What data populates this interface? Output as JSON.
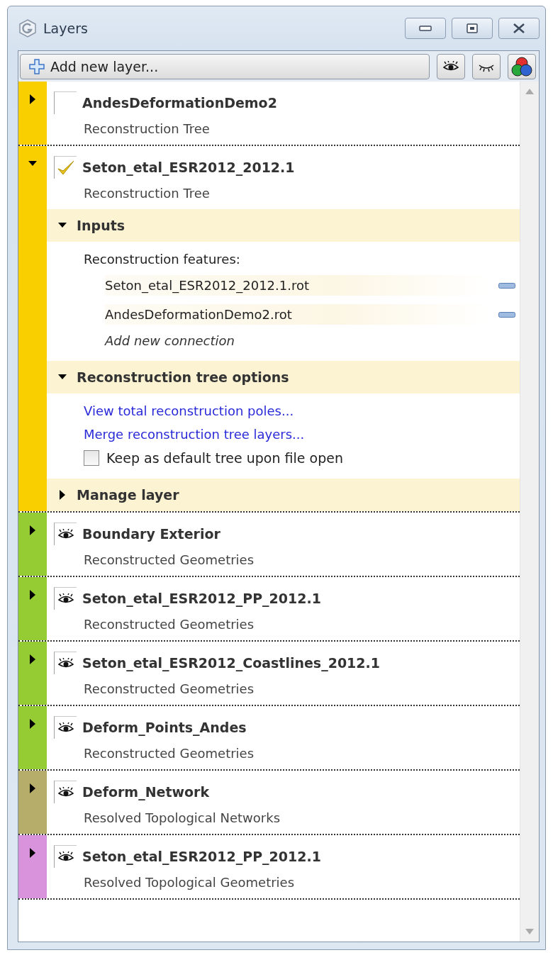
{
  "window": {
    "title": "Layers"
  },
  "toolbar": {
    "add_button": "Add new layer..."
  },
  "layers": [
    {
      "name": "AndesDeformationDemo2",
      "type": "Reconstruction Tree",
      "color": "#f9cf00",
      "expanded": false,
      "kind": "checkbox",
      "checked": false
    },
    {
      "name": "Seton_etal_ESR2012_2012.1",
      "type": "Reconstruction Tree",
      "color": "#f9cf00",
      "expanded": true,
      "kind": "checkbox",
      "checked": true,
      "sections": [
        {
          "kind": "inputs",
          "title": "Inputs",
          "expanded": true,
          "label": "Reconstruction features:",
          "connections": [
            "Seton_etal_ESR2012_2012.1.rot",
            "AndesDeformationDemo2.rot"
          ],
          "add_connection": "Add new connection"
        },
        {
          "kind": "options",
          "title": "Reconstruction tree options",
          "expanded": true,
          "links": [
            "View total reconstruction poles...",
            "Merge reconstruction tree layers..."
          ],
          "option": {
            "label": "Keep as default tree upon file open",
            "checked": false
          }
        },
        {
          "kind": "manage",
          "title": "Manage layer",
          "expanded": false
        }
      ]
    },
    {
      "name": "Boundary Exterior",
      "type": "Reconstructed Geometries",
      "color": "#95cc33",
      "expanded": false,
      "kind": "eye",
      "visible": true
    },
    {
      "name": "Seton_etal_ESR2012_PP_2012.1",
      "type": "Reconstructed Geometries",
      "color": "#95cc33",
      "expanded": false,
      "kind": "eye",
      "visible": true
    },
    {
      "name": "Seton_etal_ESR2012_Coastlines_2012.1",
      "type": "Reconstructed Geometries",
      "color": "#95cc33",
      "expanded": false,
      "kind": "eye",
      "visible": true
    },
    {
      "name": "Deform_Points_Andes",
      "type": "Reconstructed Geometries",
      "color": "#95cc33",
      "expanded": false,
      "kind": "eye",
      "visible": true
    },
    {
      "name": "Deform_Network",
      "type": "Resolved Topological Networks",
      "color": "#b7ad6a",
      "expanded": false,
      "kind": "eye",
      "visible": true
    },
    {
      "name": "Seton_etal_ESR2012_PP_2012.1",
      "type": "Resolved Topological Geometries",
      "color": "#d992dc",
      "expanded": false,
      "kind": "eye",
      "visible": true
    }
  ]
}
